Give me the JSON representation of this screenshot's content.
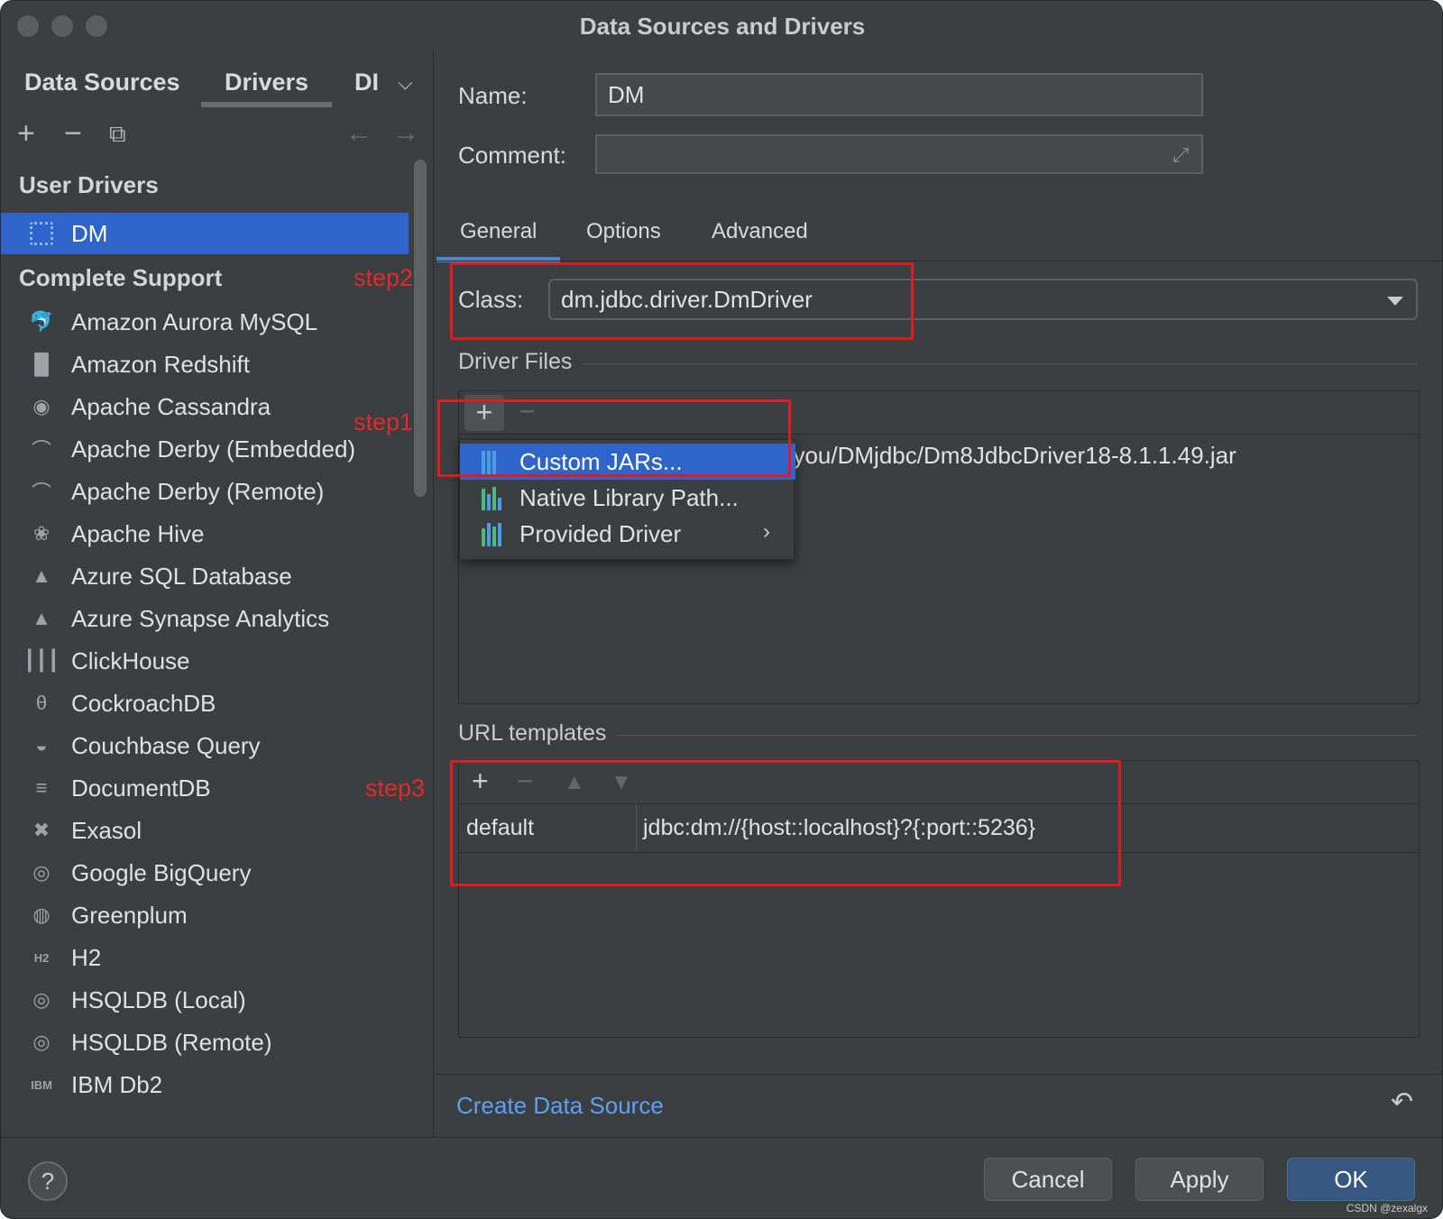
{
  "window": {
    "title": "Data Sources and Drivers"
  },
  "left": {
    "tabs": [
      "Data Sources",
      "Drivers",
      "DI"
    ],
    "sections": {
      "user_drivers": "User Drivers",
      "complete_support": "Complete Support"
    },
    "user_drivers": [
      {
        "label": "DM",
        "selected": true
      }
    ],
    "drivers": [
      {
        "label": "Amazon Aurora MySQL",
        "icon": "dolphin-icon"
      },
      {
        "label": "Amazon Redshift",
        "icon": "redshift-icon"
      },
      {
        "label": "Apache Cassandra",
        "icon": "eye-icon"
      },
      {
        "label": "Apache Derby (Embedded)",
        "icon": "hat-icon"
      },
      {
        "label": "Apache Derby (Remote)",
        "icon": "hat-icon"
      },
      {
        "label": "Apache Hive",
        "icon": "bee-icon"
      },
      {
        "label": "Azure SQL Database",
        "icon": "azure-icon"
      },
      {
        "label": "Azure Synapse Analytics",
        "icon": "azure-icon"
      },
      {
        "label": "ClickHouse",
        "icon": "bars-icon"
      },
      {
        "label": "CockroachDB",
        "icon": "cockroach-icon"
      },
      {
        "label": "Couchbase Query",
        "icon": "couchbase-icon"
      },
      {
        "label": "DocumentDB",
        "icon": "database-icon"
      },
      {
        "label": "Exasol",
        "icon": "x-icon"
      },
      {
        "label": "Google BigQuery",
        "icon": "bigquery-icon"
      },
      {
        "label": "Greenplum",
        "icon": "greenplum-icon"
      },
      {
        "label": "H2",
        "icon": "h2-icon"
      },
      {
        "label": "HSQLDB (Local)",
        "icon": "hsqldb-icon"
      },
      {
        "label": "HSQLDB (Remote)",
        "icon": "hsqldb-icon"
      },
      {
        "label": "IBM Db2",
        "icon": "ibm-db2-icon"
      }
    ]
  },
  "annotations": {
    "step1": "step1",
    "step2": "step2",
    "step3": "step3"
  },
  "form": {
    "name_label": "Name:",
    "name_value": "DM",
    "comment_label": "Comment:",
    "comment_value": ""
  },
  "tabs": [
    "General",
    "Options",
    "Advanced"
  ],
  "general": {
    "class_label": "Class:",
    "class_value": "dm.jdbc.driver.DmDriver",
    "driver_files_title": "Driver Files",
    "driver_file_visible": "gyou/DMjdbc/Dm8JdbcDriver18-8.1.1.49.jar",
    "url_templates_title": "URL templates",
    "url_templates": [
      {
        "name": "default",
        "value": "jdbc:dm://{host::localhost}?{:port::5236}"
      }
    ]
  },
  "popup": {
    "items": [
      {
        "label": "Custom JARs...",
        "selected": true
      },
      {
        "label": "Native Library Path..."
      },
      {
        "label": "Provided Driver",
        "submenu": true
      }
    ]
  },
  "footer": {
    "create_link": "Create Data Source",
    "help": "?",
    "cancel": "Cancel",
    "apply": "Apply",
    "ok": "OK",
    "watermark": "CSDN @zexalgx"
  }
}
